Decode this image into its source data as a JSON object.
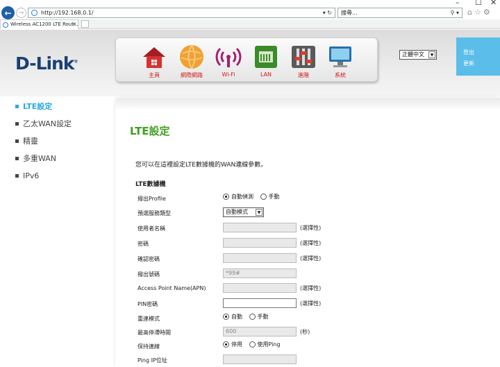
{
  "browser": {
    "url": "http://192.168.0.1/",
    "search_placeholder": "搜尋...",
    "tab_title": "Wireless AC1200 LTE Rout...",
    "window_controls": [
      "–",
      "☐",
      "✕"
    ]
  },
  "brand": {
    "logo": "D-Link",
    "accent": "#2aa9e0",
    "title_color": "#3e9f1d"
  },
  "nav": [
    {
      "label": "主頁",
      "icon": "home-icon"
    },
    {
      "label": "網際網路",
      "icon": "globe-icon"
    },
    {
      "label": "Wi-Fi",
      "icon": "wifi-icon"
    },
    {
      "label": "LAN",
      "icon": "lan-icon"
    },
    {
      "label": "進階",
      "icon": "tools-icon"
    },
    {
      "label": "系統",
      "icon": "monitor-icon"
    }
  ],
  "language": "正體中文",
  "account": {
    "logout": "登出",
    "update": "更新"
  },
  "sidebar": [
    {
      "label": "LTE設定",
      "active": true
    },
    {
      "label": "乙太WAN設定",
      "active": false
    },
    {
      "label": "精靈",
      "active": false
    },
    {
      "label": "多重WAN",
      "active": false
    },
    {
      "label": "IPv6",
      "active": false
    }
  ],
  "main": {
    "title": "LTE設定",
    "description": "您可以在這裡設定LTE數據機的WAN連線參數。",
    "section": "LTE數據機",
    "rows": {
      "profile": {
        "label": "撥出Profile",
        "opt1": "自動偵測",
        "opt2": "手動"
      },
      "service": {
        "label": "預選服務類型",
        "value": "自動模式"
      },
      "username": {
        "label": "使用者名稱",
        "value": "",
        "note": "(選擇性)"
      },
      "password": {
        "label": "密碼",
        "value": "",
        "note": "(選擇性)"
      },
      "confirm": {
        "label": "確認密碼",
        "value": "",
        "note": "(選擇性)"
      },
      "dial": {
        "label": "撥出號碼",
        "value": "*99#"
      },
      "apn": {
        "label": "Access Point Name(APN)",
        "value": "",
        "note": "(選擇性)"
      },
      "pin": {
        "label": "PIN密碼",
        "value": "",
        "note": "(選擇性)"
      },
      "reconnect": {
        "label": "重連模式",
        "opt1": "自動",
        "opt2": "手動"
      },
      "idle": {
        "label": "最高停滯時間",
        "value": "600",
        "note": "(秒)"
      },
      "keepalive": {
        "label": "保持連線",
        "opt1": "停用",
        "opt2": "使用Ping"
      },
      "ping_ip": {
        "label": "Ping IP位址",
        "value": ""
      }
    }
  }
}
